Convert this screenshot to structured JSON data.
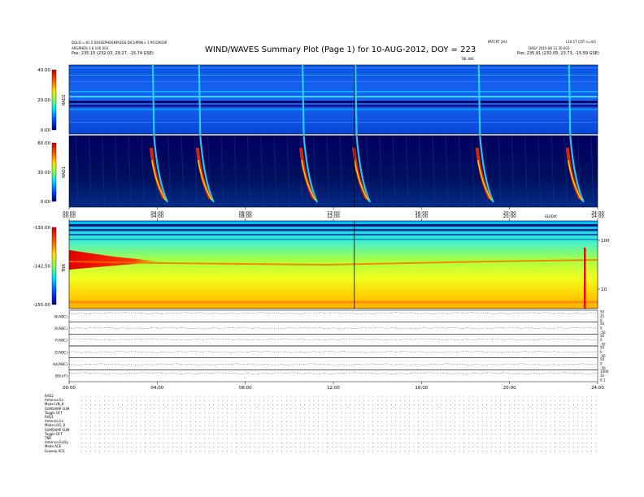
{
  "header": {
    "title": "WIND/WAVES Summary Plot (Page 1) for 10-AUG-2012, DOY = 223",
    "left_line1": "DOLD = 81.5 [DOSEPHOSNP(DOS.DIC)(PRN)> 1 PICOROSP",
    "left_line2": "ARGPHOS 3 8 100 003",
    "left_line3": "Pos: 235.15 (232.03, 29.27, -15.74 GSE)",
    "right_label1": "PATCRT 2A3",
    "right_label2": "L10 1T COT n=4r1",
    "right_label3": "DAILY 2010.08 11.30.003",
    "right_line3": "Pos: 235.91 (232.05, 23.73, -15.59 GSE)",
    "tb_label": "TBL-INX"
  },
  "chart_data": [
    {
      "type": "heatmap",
      "name": "RAD2",
      "xlabel": "",
      "ylabel": "RAD2",
      "ylim": [
        0.0,
        40.0
      ],
      "colorbar_ticks": [
        "40.00",
        "20.00",
        "0.00"
      ]
    },
    {
      "type": "heatmap",
      "name": "RAD1",
      "ylabel": "RAD1",
      "ylim": [
        0.0,
        60.0
      ],
      "colorbar_ticks": [
        "60.00",
        "30.00",
        "0.00"
      ],
      "xticks": [
        "00:00",
        "04:00",
        "08:00",
        "12:00",
        "16:00",
        "20:00",
        "24:00"
      ],
      "xlim_hours": [
        0,
        24
      ],
      "type_iii_bursts_hours": [
        3.8,
        5.9,
        10.6,
        13.0,
        18.6,
        22.7
      ]
    },
    {
      "type": "heatmap",
      "name": "TNR",
      "ylabel": "TNR",
      "ylim": [
        -155.0,
        -130.0
      ],
      "colorbar_ticks": [
        "-130.00",
        "-142.50",
        "-155.00"
      ],
      "xticks": [
        "00:00",
        "04:00",
        "08:00",
        "12:00",
        "16:00",
        "20:00",
        "24:00"
      ],
      "right_axis_ticks": [
        "100",
        "10"
      ],
      "top_right_label": "EEXDIX"
    },
    {
      "type": "line",
      "name": "Magnetometer",
      "panels": [
        {
          "label": "B(ABC)",
          "right_ticks": [
            "50",
            "25",
            "0"
          ],
          "level": 0.75
        },
        {
          "label": "X(ABC)",
          "right_ticks": [
            "50",
            "0",
            "-50"
          ],
          "level": 0.5
        },
        {
          "label": "Y(ABC)",
          "right_ticks": [
            "50",
            "0",
            "-50"
          ],
          "level": 0.55
        },
        {
          "label": "Z(ABC)",
          "right_ticks": [
            "50",
            "0",
            "-50"
          ],
          "level": 0.5
        },
        {
          "label": "Az(ABC)",
          "right_ticks": [
            "50",
            "0",
            "-50"
          ],
          "level": 0.45
        },
        {
          "label": "|B|(nT)",
          "right_ticks": [
            "1000",
            "10",
            "0.1"
          ],
          "level": 0.7
        }
      ],
      "xticks": [
        "00:00",
        "04:00",
        "08:00",
        "12:00",
        "16:00",
        "20:00",
        "24:00"
      ]
    }
  ],
  "footer": {
    "lines": [
      "RAD2",
      "Antenna   Ex",
      "Mode   LIN_8",
      "SUMSAMP SUM",
      "Toggle   OFF",
      "RAD1",
      "Antenna   Ex",
      "Mode   LOG_8",
      "SUMSAMP SUM",
      "Toggle   OFF",
      "TNR",
      "Antenna   Ex/Ey",
      "Mode   ACE",
      "Ssweep   ACE"
    ]
  }
}
